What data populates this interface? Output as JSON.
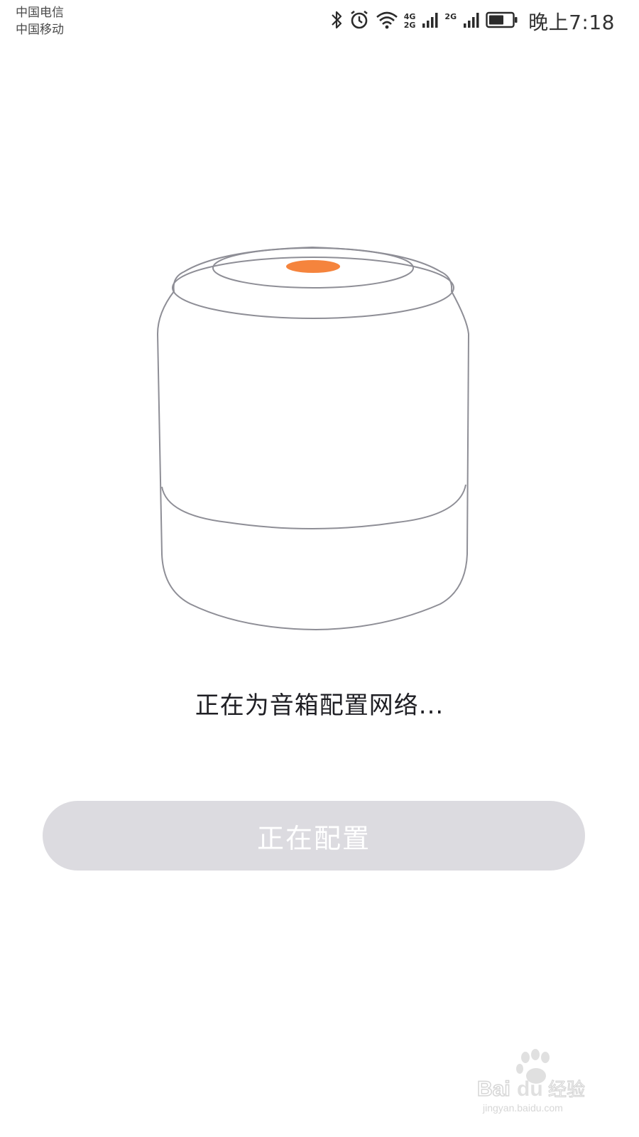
{
  "status_bar": {
    "carrier_1": "中国电信",
    "carrier_2": "中国移动",
    "network_1_top": "4G",
    "network_1_bottom": "2G",
    "network_2": "2G",
    "time": "晚上7:18",
    "icons": [
      "bluetooth-icon",
      "alarm-icon",
      "wifi-icon",
      "signal-icon",
      "signal-icon",
      "battery-icon"
    ]
  },
  "main": {
    "status_text": "正在为音箱配置网络...",
    "button_label": "正在配置"
  },
  "colors": {
    "accent_dot": "#f5843d",
    "button_bg": "#dcdbe0",
    "outline": "#8e8e96"
  },
  "watermark": {
    "brand": "Baidu经验",
    "url": "jingyan.baidu.com"
  }
}
